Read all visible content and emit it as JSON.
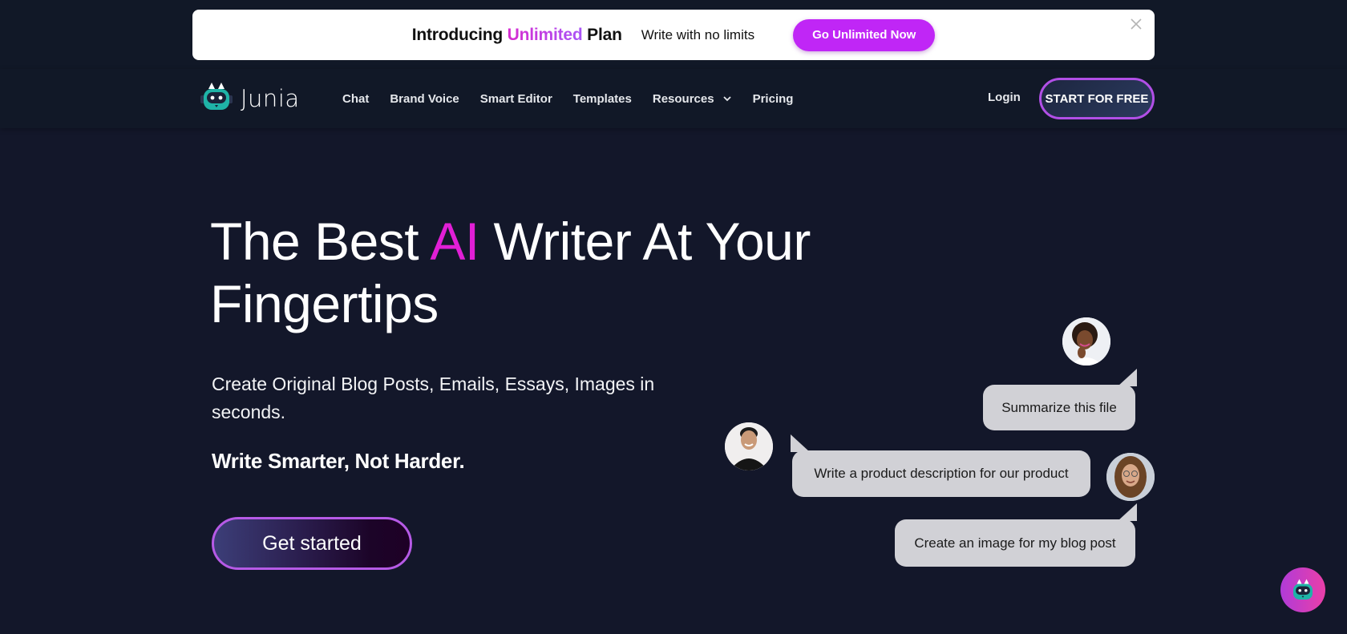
{
  "banner": {
    "title_prefix": "Introducing",
    "title_accent": "Unlimited",
    "title_suffix": "Plan",
    "subtitle": "Write with no limits",
    "cta_label": "Go Unlimited Now",
    "close_icon": "close-icon"
  },
  "nav": {
    "logo_text": "Junia",
    "links": [
      {
        "label": "Chat"
      },
      {
        "label": "Brand Voice"
      },
      {
        "label": "Smart Editor"
      },
      {
        "label": "Templates"
      },
      {
        "label": "Resources",
        "has_dropdown": true
      },
      {
        "label": "Pricing"
      }
    ],
    "login_label": "Login",
    "start_label": "START FOR FREE"
  },
  "hero": {
    "title_part1": "The Best",
    "title_accent": "AI",
    "title_part2": "Writer At Your Fingertips",
    "subtitle": "Create Original Blog Posts, Emails, Essays, Images in seconds.",
    "tagline": "Write Smarter, Not Harder.",
    "cta_label": "Get started"
  },
  "chat": {
    "messages": [
      {
        "text": "Summarize this file",
        "side": "right",
        "avatar": "woman-avatar"
      },
      {
        "text": "Write a product description for our product",
        "side": "left",
        "avatar": "man-avatar"
      },
      {
        "text": "Create an image for my blog post",
        "side": "right",
        "avatar": "long-hair-man-avatar"
      }
    ]
  },
  "colors": {
    "background": "#13172a",
    "nav_background": "#111827",
    "accent_magenta": "#e11fd6",
    "banner_cta": "#c026f6",
    "button_border": "#b14fe6",
    "bubble": "#d1d1d6",
    "logo_teal": "#1fb3a7"
  }
}
